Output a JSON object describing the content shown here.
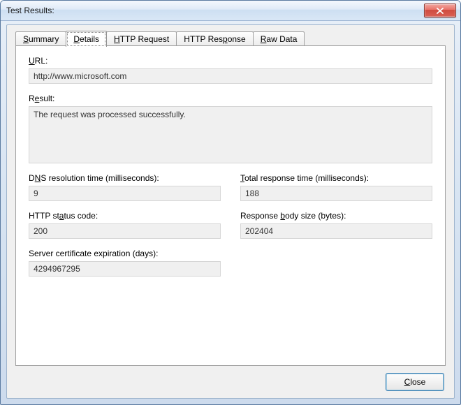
{
  "window": {
    "title": "Test Results:"
  },
  "tabs": {
    "summary": "Summary",
    "details": "Details",
    "http_request": "HTTP Request",
    "http_response": "HTTP Response",
    "raw_data": "Raw Data"
  },
  "labels": {
    "url": "URL:",
    "result": "Result:",
    "dns_full": "DNS resolution time (milliseconds):",
    "total_full": "Total response time (milliseconds):",
    "status_full": "HTTP status code:",
    "body_full": "Response body size (bytes):",
    "cert": "Server certificate expiration (days):"
  },
  "values": {
    "url": "http://www.microsoft.com",
    "result": "The request was processed successfully.",
    "dns": "9",
    "total": "188",
    "status": "200",
    "body": "202404",
    "cert": "4294967295"
  },
  "buttons": {
    "close": "Close"
  }
}
